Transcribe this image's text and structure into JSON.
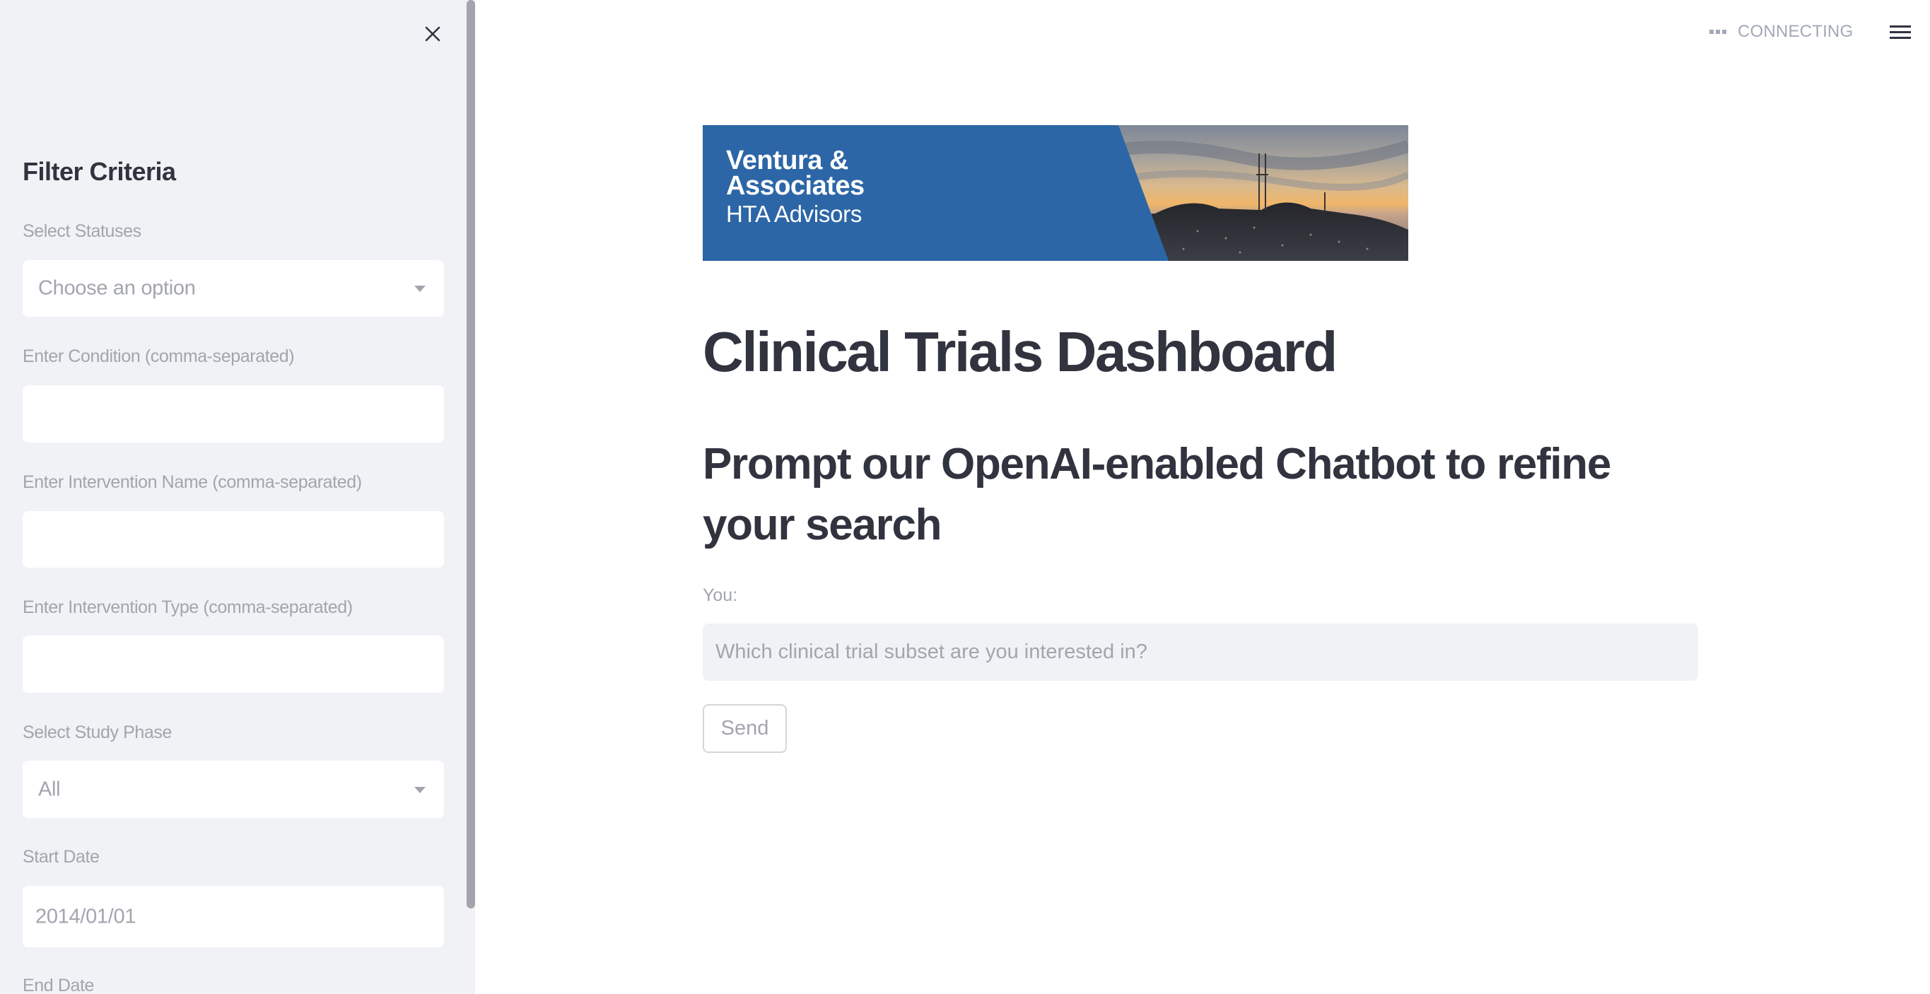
{
  "sidebar": {
    "close_icon": "close-icon",
    "title": "Filter Criteria",
    "fields": [
      {
        "label": "Select Statuses",
        "type": "select",
        "value": "Choose an option",
        "placeholder": "Choose an option"
      },
      {
        "label": "Enter Condition (comma-separated)",
        "type": "text",
        "value": ""
      },
      {
        "label": "Enter Intervention Name (comma-separated)",
        "type": "text",
        "value": ""
      },
      {
        "label": "Enter Intervention Type (comma-separated)",
        "type": "text",
        "value": ""
      },
      {
        "label": "Select Study Phase",
        "type": "select",
        "value": "All"
      },
      {
        "label": "Start Date",
        "type": "date",
        "value": "2014/01/01"
      },
      {
        "label": "End Date",
        "type": "date",
        "value": ""
      }
    ]
  },
  "header": {
    "status_text": "CONNECTING",
    "status_icon": "dots-icon",
    "menu_icon": "hamburger-menu-icon"
  },
  "main": {
    "banner": {
      "line1": "Ventura &",
      "line2": "Associates",
      "line3": "HTA Advisors",
      "brand_color": "#2C66A6"
    },
    "title": "Clinical Trials Dashboard",
    "subtitle": "Prompt our OpenAI-enabled Chatbot to refine your search",
    "chat": {
      "label": "You:",
      "placeholder": "Which clinical trial subset are you interested in?",
      "value": "",
      "send_label": "Send"
    }
  }
}
